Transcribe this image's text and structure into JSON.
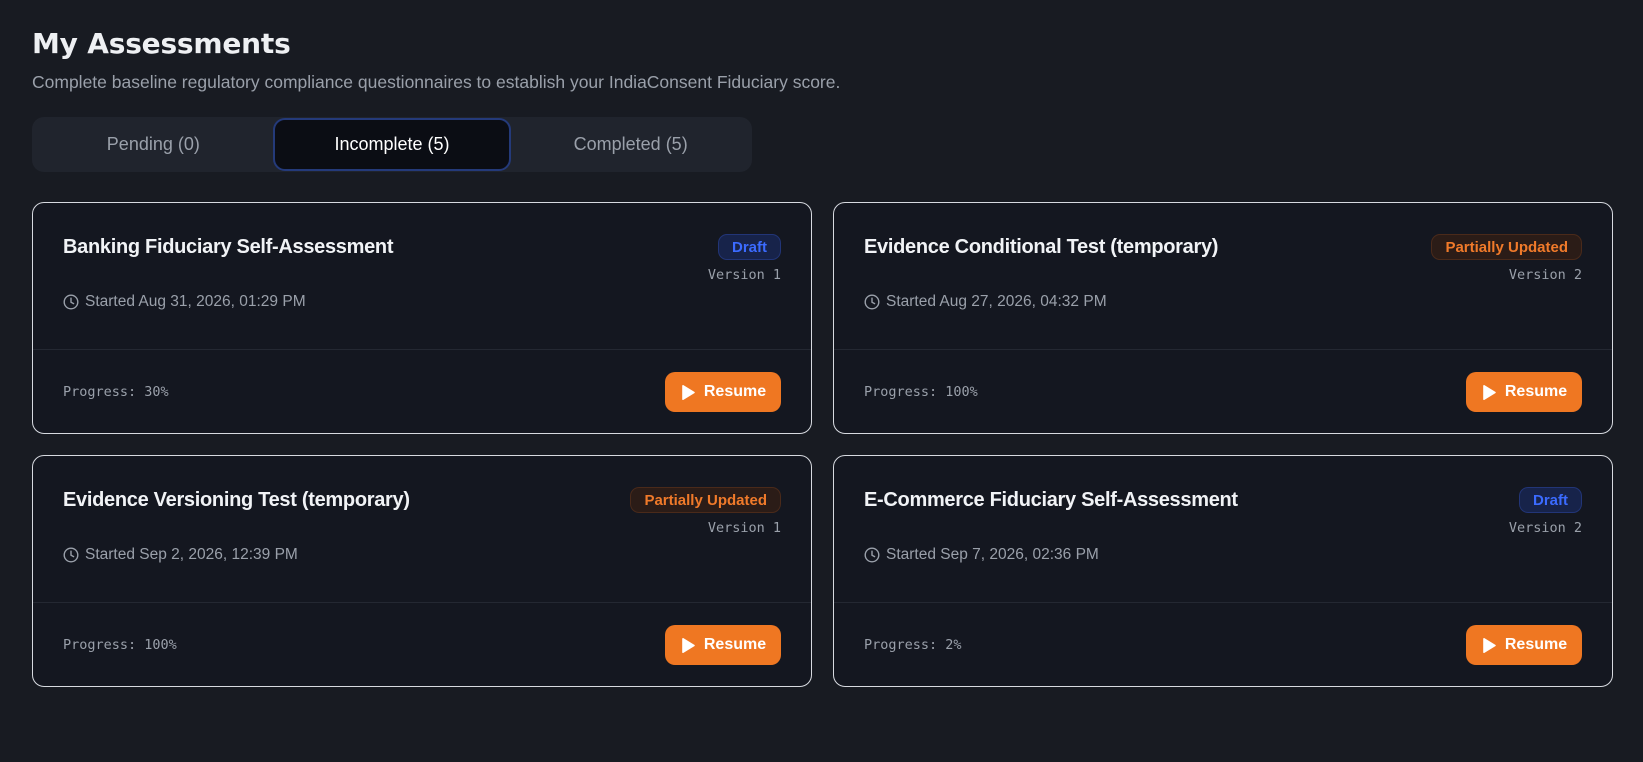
{
  "header": {
    "title": "My Assessments",
    "subtitle": "Complete baseline regulatory compliance questionnaires to establish your IndiaConsent Fiduciary score."
  },
  "tabs": [
    {
      "label": "Pending (0)",
      "active": false
    },
    {
      "label": "Incomplete (5)",
      "active": true
    },
    {
      "label": "Completed (5)",
      "active": false
    }
  ],
  "assessments": [
    {
      "title": "Banking Fiduciary Self-Assessment",
      "status": "Draft",
      "status_kind": "draft",
      "version": "Version 1",
      "started": "Started Aug 31, 2026, 01:29 PM",
      "progress_label": "Progress: 30%",
      "progress_pct": 30,
      "action_label": "Resume"
    },
    {
      "title": "Evidence Conditional Test (temporary)",
      "status": "Partially Updated",
      "status_kind": "partial",
      "version": "Version 2",
      "started": "Started Aug 27, 2026, 04:32 PM",
      "progress_label": "Progress: 100%",
      "progress_pct": 100,
      "action_label": "Resume"
    },
    {
      "title": "Evidence Versioning Test (temporary)",
      "status": "Partially Updated",
      "status_kind": "partial",
      "version": "Version 1",
      "started": "Started Sep 2, 2026, 12:39 PM",
      "progress_label": "Progress: 100%",
      "progress_pct": 100,
      "action_label": "Resume"
    },
    {
      "title": "E-Commerce Fiduciary Self-Assessment",
      "status": "Draft",
      "status_kind": "draft",
      "version": "Version 2",
      "started": "Started Sep 7, 2026, 02:36 PM",
      "progress_label": "Progress: 2%",
      "progress_pct": 2,
      "action_label": "Resume"
    }
  ],
  "icons": {
    "started": "clock-icon",
    "resume": "play-icon"
  },
  "colors": {
    "background": "#181b22",
    "accent": "#ef7722",
    "draft": "#3b6bff",
    "partial": "#f07a2a"
  }
}
